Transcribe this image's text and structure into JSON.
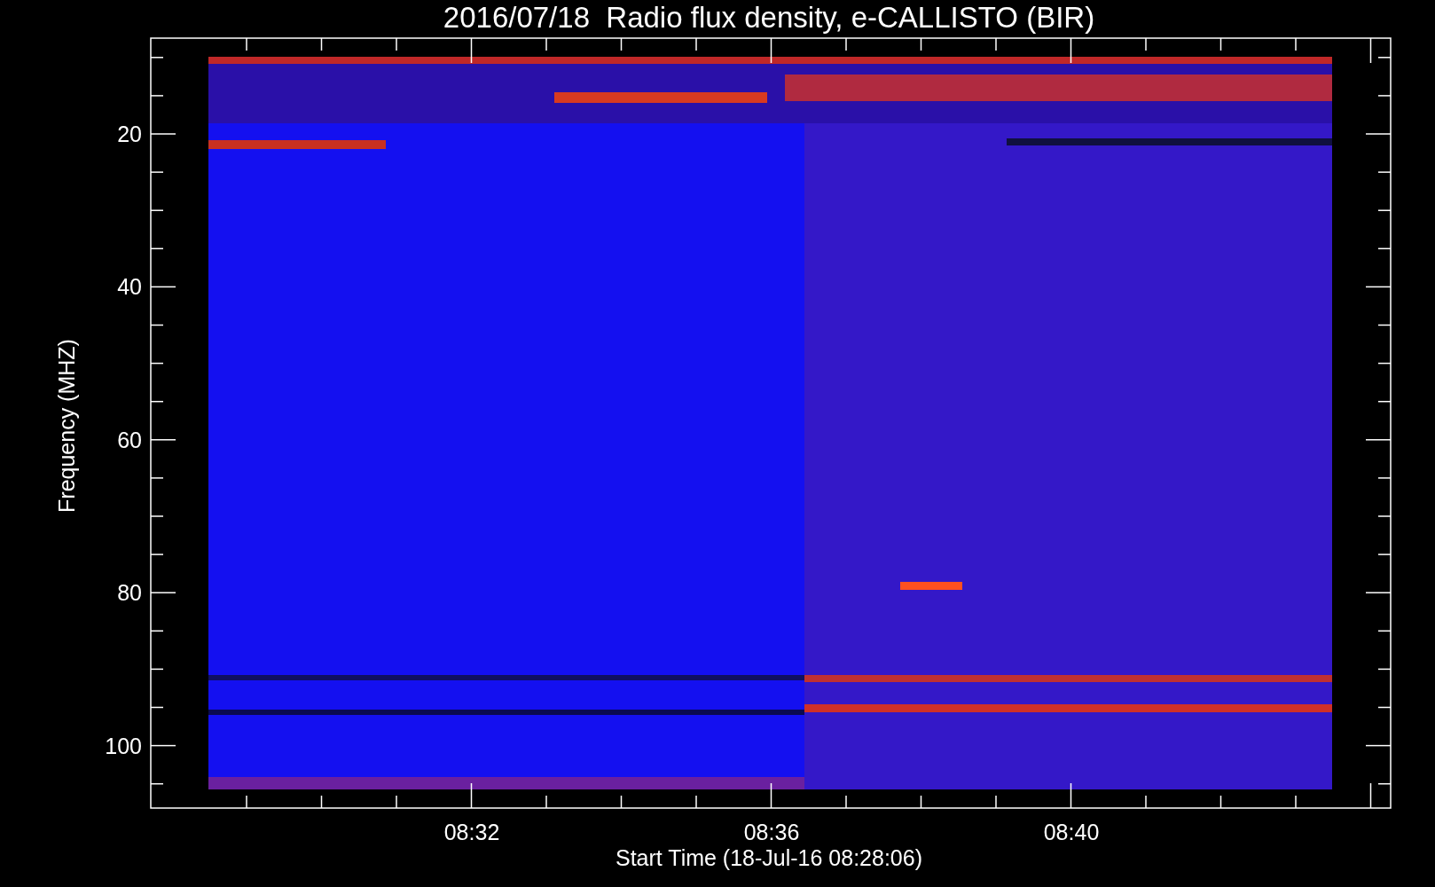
{
  "title": "2016/07/18  Radio flux density, e-CALLISTO (BIR)",
  "y_axis": {
    "label": "Frequency (MHZ)",
    "ticks": [
      "20",
      "40",
      "60",
      "80",
      "100"
    ]
  },
  "x_axis": {
    "label": "Start Time (18-Jul-16 08:28:06)",
    "ticks": [
      "08:32",
      "08:36",
      "08:40"
    ]
  }
}
